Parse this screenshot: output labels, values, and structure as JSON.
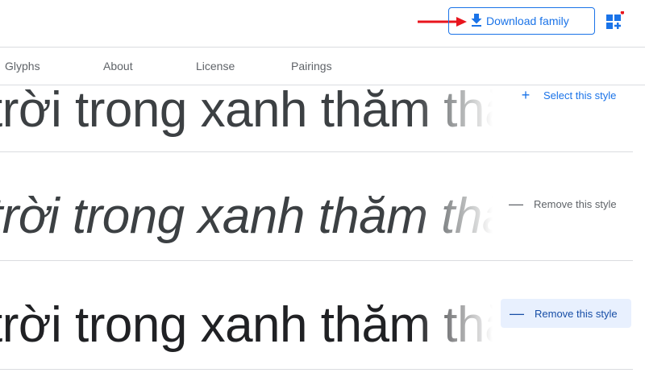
{
  "header": {
    "download_label": "Download family",
    "download_icon": "download-icon",
    "apps_icon": "grid-plus-icon",
    "accent_color": "#1a73e8",
    "annotation_arrow_color": "#e8141d"
  },
  "tabs": [
    {
      "label": "Glyphs"
    },
    {
      "label": "About"
    },
    {
      "label": "License"
    },
    {
      "label": "Pairings"
    }
  ],
  "styles": [
    {
      "sample": "trời trong xanh thăm thẳm",
      "action": "Select this style",
      "action_icon": "+"
    },
    {
      "sample": "trời trong xanh thăm thẳm",
      "action": "Remove this style",
      "action_icon": "—"
    },
    {
      "sample": "trời trong xanh thăm thẳm",
      "action": "Remove this style",
      "action_icon": "—"
    }
  ]
}
